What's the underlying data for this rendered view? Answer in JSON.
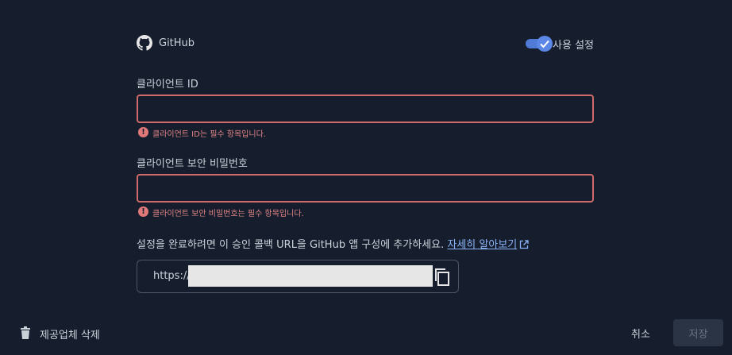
{
  "provider": {
    "name": "GitHub",
    "icon": "github-icon",
    "enabled": true,
    "toggle_label": "사용 설정"
  },
  "fields": {
    "client_id": {
      "label": "클라이언트 ID",
      "value": "",
      "error": "클라이언트 ID는 필수 항목입니다."
    },
    "client_secret": {
      "label": "클라이언트 보안 비밀번호",
      "value": "",
      "error": "클라이언트 보안 비밀번호는 필수 항목입니다."
    }
  },
  "callback": {
    "instructions": "설정을 완료하려면 이 승인 콜백 URL을 GitHub 앱 구성에 추가하세요.",
    "learn_more": "자세히 알아보기",
    "url_prefix": "https://"
  },
  "footer": {
    "delete_label": "제공업체 삭제",
    "cancel_label": "취소",
    "save_label": "저장"
  },
  "colors": {
    "background": "#161e2e",
    "error": "#d16a6a",
    "accent": "#4f7ad6",
    "link": "#8ab4f8"
  }
}
